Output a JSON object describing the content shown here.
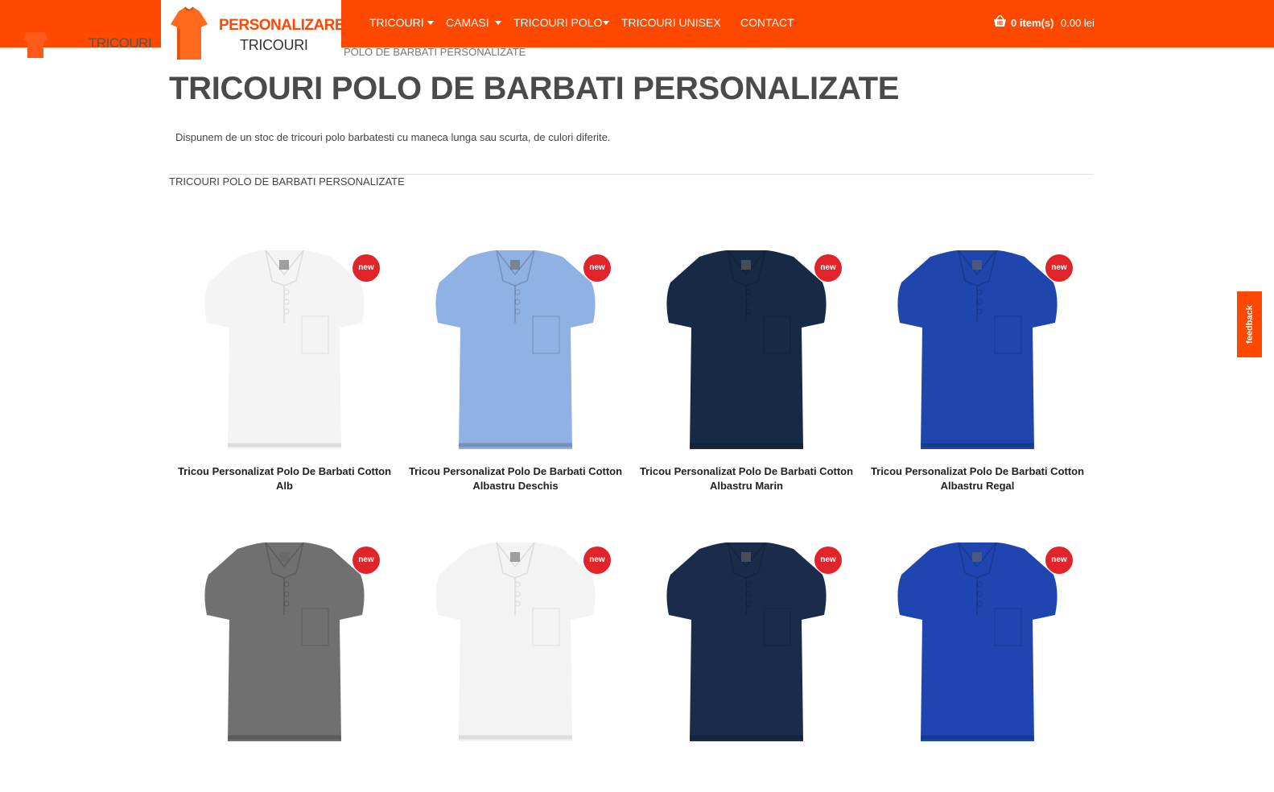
{
  "brand": {
    "line1": "PERSONALIZARE",
    "line2": "TRICOURI",
    "bg_text": "TRICOURI",
    "accent": "#ff4800"
  },
  "nav": {
    "items": [
      {
        "label": "TRICOURI",
        "has_dropdown": true
      },
      {
        "label": "CAMASI",
        "has_dropdown": true
      },
      {
        "label": "TRICOURI POLO",
        "has_dropdown": true
      },
      {
        "label": "TRICOURI UNISEX",
        "has_dropdown": false
      },
      {
        "label": "CONTACT",
        "has_dropdown": false
      }
    ]
  },
  "cart": {
    "items": "0 item(s)",
    "total": "0.00 lei",
    "icon": "basket-icon"
  },
  "breadcrumb": "POLO DE BARBATI PERSONALIZATE",
  "page": {
    "title": "TRICOURI POLO DE BARBATI PERSONALIZATE",
    "description": "Dispunem de un stoc de tricouri polo barbatesti cu maneca lunga sau scurta, de culori diferite.",
    "subcategory": "TRICOURI POLO DE BARBATI PERSONALIZATE"
  },
  "products": [
    {
      "line1": "Tricou Personalizat Polo De Barbati Cotton",
      "line2": "Alb",
      "badge": "new",
      "color": "#f4f4f4"
    },
    {
      "line1": "Tricou Personalizat Polo De Barbati Cotton",
      "line2": "Albastru Deschis",
      "badge": "new",
      "color": "#8fb1e3"
    },
    {
      "line1": "Tricou Personalizat Polo De Barbati Cotton",
      "line2": "Albastru Marin",
      "badge": "new",
      "color": "#172a45"
    },
    {
      "line1": "Tricou Personalizat Polo De Barbati Cotton",
      "line2": "Albastru Regal",
      "badge": "new",
      "color": "#1f46ad"
    },
    {
      "line1": "",
      "line2": "",
      "badge": "new",
      "color": "#707070"
    },
    {
      "line1": "",
      "line2": "",
      "badge": "new",
      "color": "#f3f3f3"
    },
    {
      "line1": "",
      "line2": "",
      "badge": "new",
      "color": "#1a2c4a"
    },
    {
      "line1": "",
      "line2": "",
      "badge": "new",
      "color": "#1f46b0"
    }
  ],
  "feedback": "feedback"
}
